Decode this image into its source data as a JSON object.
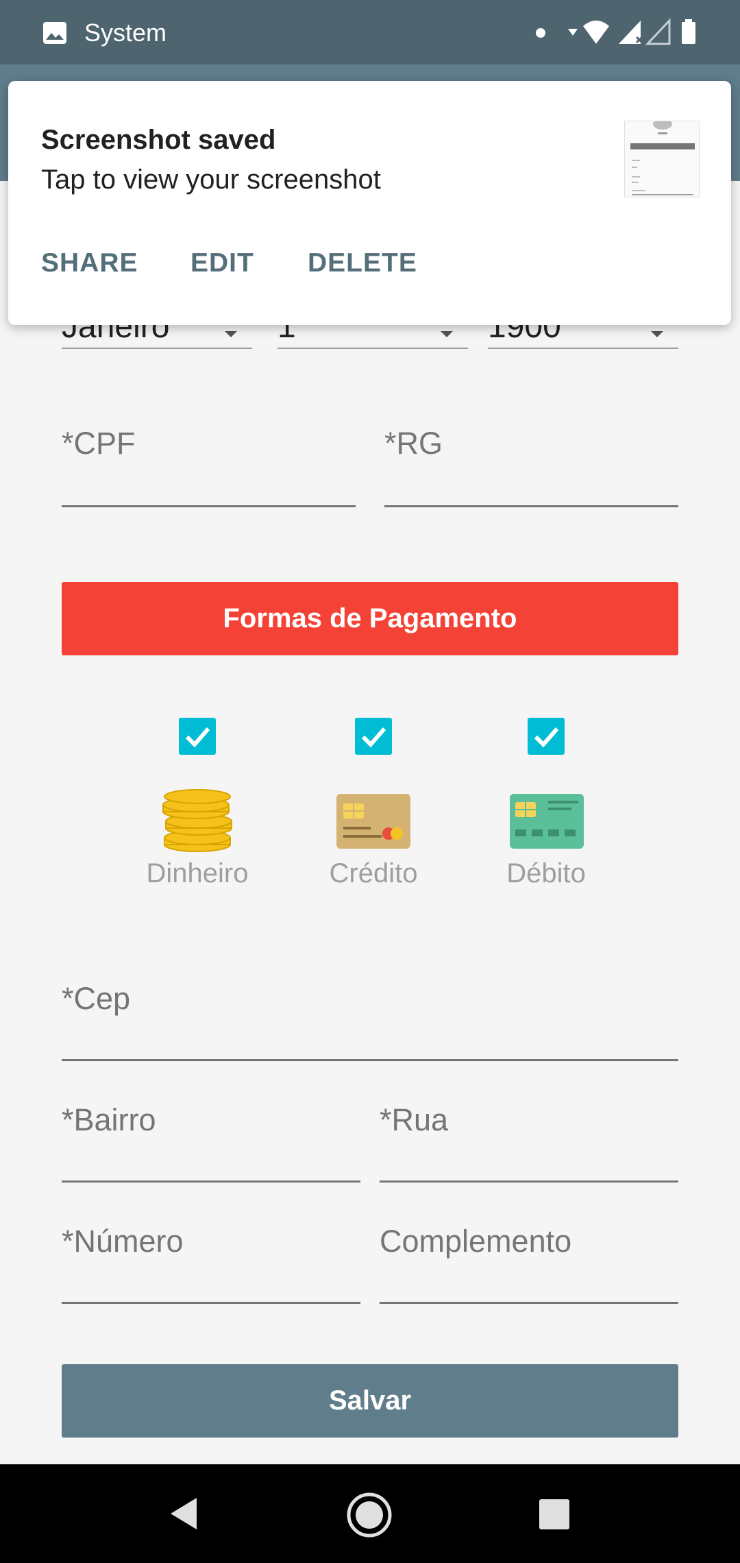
{
  "status_bar": {
    "app_name": "System",
    "icons": [
      "image-icon",
      "dot-icon",
      "data-arrow-icon",
      "wifi-icon",
      "signal-icon",
      "signal-empty-icon",
      "battery-icon"
    ]
  },
  "notification": {
    "title": "Screenshot saved",
    "text": "Tap to view your screenshot",
    "actions": {
      "share": "SHARE",
      "edit": "EDIT",
      "delete": "DELETE"
    }
  },
  "birth_date": {
    "month": "Janeiro",
    "day": "1",
    "year": "1900"
  },
  "form": {
    "cpf_label": "*CPF",
    "rg_label": "*RG",
    "cep_label": "*Cep",
    "bairro_label": "*Bairro",
    "rua_label": "*Rua",
    "numero_label": "*Número",
    "complemento_label": "Complemento"
  },
  "payment": {
    "header": "Formas de Pagamento",
    "options": [
      {
        "label": "Dinheiro",
        "checked": true,
        "icon": "coins-icon"
      },
      {
        "label": "Crédito",
        "checked": true,
        "icon": "credit-card-icon"
      },
      {
        "label": "Débito",
        "checked": true,
        "icon": "debit-card-icon"
      }
    ]
  },
  "actions": {
    "save_label": "Salvar"
  },
  "colors": {
    "status_bar": "#4e646f",
    "app_bar": "#607d8b",
    "payment_header": "#f44336",
    "checkbox": "#00bcd4",
    "save_button": "#607d8b"
  }
}
